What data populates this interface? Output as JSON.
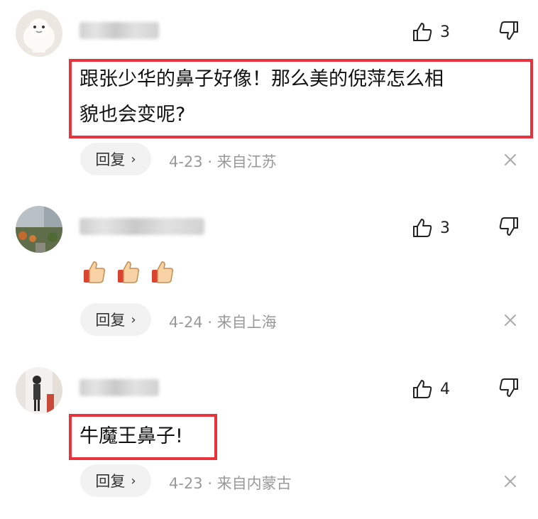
{
  "comments": [
    {
      "likes": "3",
      "text_line1": "跟张少华的鼻子好像！那么美的倪萍怎么相",
      "text_line2": "貌也会变呢?",
      "reply_label": "回复",
      "reply_chevron": "›",
      "meta": "4-23 · 来自江苏",
      "avatar": "cat-avatar"
    },
    {
      "likes": "3",
      "emojis": [
        "thumbs-up-emoji",
        "thumbs-up-emoji",
        "thumbs-up-emoji"
      ],
      "reply_label": "回复",
      "reply_chevron": "›",
      "meta": "4-24 · 来自上海",
      "avatar": "street-avatar"
    },
    {
      "likes": "4",
      "text_line1": "牛魔王鼻子!",
      "reply_label": "回复",
      "reply_chevron": "›",
      "meta": "4-23 · 来自内蒙古",
      "avatar": "person-avatar"
    }
  ],
  "colors": {
    "highlight": "#e8333d",
    "meta": "#999999",
    "reply_bg": "#f2f2f2"
  }
}
